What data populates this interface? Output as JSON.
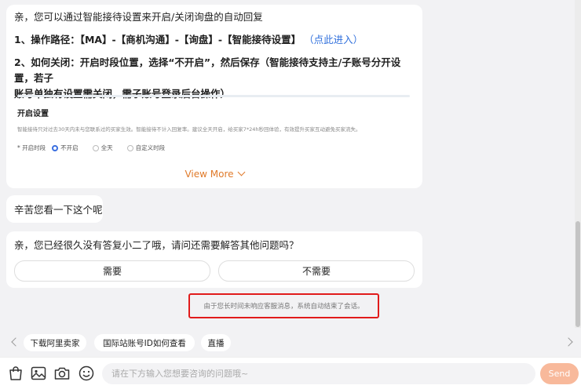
{
  "message1": {
    "line1": "亲，您可以通过智能接待设置来开启/关闭询盘的自动回复",
    "path_prefix": "1、操作路径：【MA】-【商机沟通】-【询盘】-【智能接待设置】",
    "path_link_open": "（",
    "path_link": "点此进入",
    "path_link_close": "）",
    "close_line1": "2、如何关闭：开启时段位置，选择“不开启”，然后保存（智能接待支持主/子账号分开设置，若子",
    "close_line2": "账号单独有设置需关闭，需子账号登录后台操作）",
    "preview": {
      "title": "开启设置",
      "desc": "智能接待只对过去30天内未与您联系过的买家生效。智能接待不计入回复率。建议全天开启，给买家7*24h秒回体验，有效提升买家互动避免买家流失。",
      "radio_label": "* 开启时段",
      "options": [
        "不开启",
        "全天",
        "自定义时段"
      ]
    },
    "view_more": "View More"
  },
  "message2": {
    "text": "辛苦您看一下这个呢"
  },
  "message3": {
    "question": "亲，您已经很久没有答复小二了哦，请问还需要解答其他问题吗？",
    "yes_label": "需要",
    "no_label": "不需要"
  },
  "system_note": "由于您长时间未响应客服消息，系统自动结束了会话。",
  "quick_chips": [
    "下载阿里卖家",
    "国际站账号ID如何查看",
    "直播"
  ],
  "input": {
    "placeholder": "请在下方输入您想要咨询的问题哦~",
    "send_label": "Send"
  },
  "colors": {
    "accent": "#e07a2a",
    "link": "#2f6fdc",
    "send_bg": "#f8b99b",
    "highlight": "#e11b1b"
  }
}
